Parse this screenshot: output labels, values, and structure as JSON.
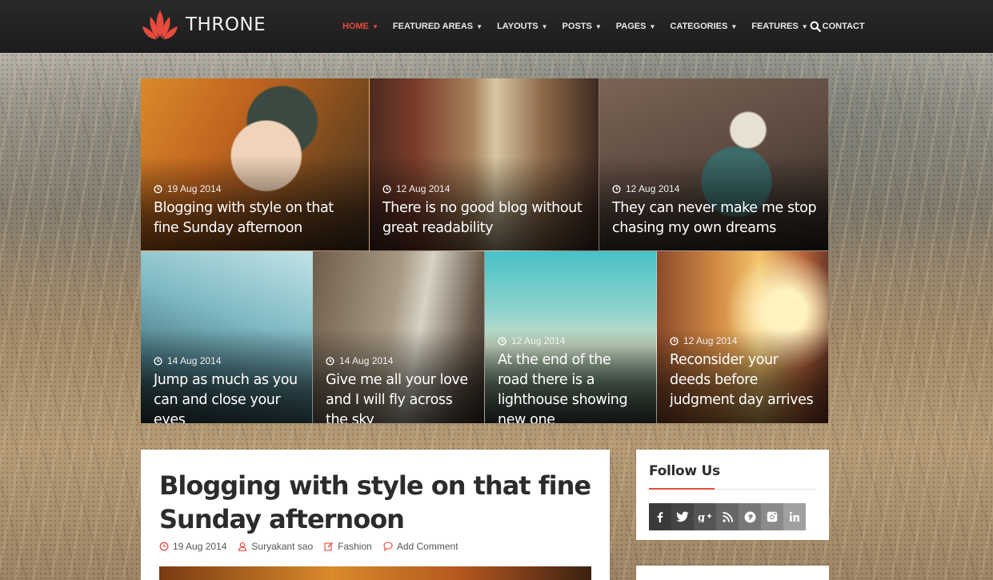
{
  "header": {
    "logo_text": "THRONE",
    "nav": [
      {
        "label": "HOME",
        "active": true,
        "has_dropdown": true
      },
      {
        "label": "FEATURED AREAS",
        "has_dropdown": true
      },
      {
        "label": "LAYOUTS",
        "has_dropdown": true
      },
      {
        "label": "POSTS",
        "has_dropdown": true
      },
      {
        "label": "PAGES",
        "has_dropdown": true
      },
      {
        "label": "CATEGORIES",
        "has_dropdown": true
      },
      {
        "label": "FEATURES",
        "has_dropdown": true
      },
      {
        "label": "CONTACT",
        "has_dropdown": false
      }
    ],
    "search_icon": "search-icon"
  },
  "featured": [
    {
      "date": "19 Aug 2014",
      "title": "Blogging with style on that fine Sunday afternoon"
    },
    {
      "date": "12 Aug 2014",
      "title": "There is no good blog without great readability"
    },
    {
      "date": "12 Aug 2014",
      "title": "They can never make me stop chasing my own dreams"
    },
    {
      "date": "14 Aug 2014",
      "title": "Jump as much as you can and close your eyes"
    },
    {
      "date": "14 Aug 2014",
      "title": "Give me all your love and I will fly across the sky"
    },
    {
      "date": "12 Aug 2014",
      "title": "At the end of the road there is a lighthouse showing new one"
    },
    {
      "date": "12 Aug 2014",
      "title": "Reconsider your deeds before judgment day arrives"
    }
  ],
  "post": {
    "title": "Blogging with style on that fine Sunday afternoon",
    "date": "19 Aug 2014",
    "author": "Suryakant sao",
    "category": "Fashion",
    "comments": "Add Comment"
  },
  "sidebar": {
    "follow_title": "Follow Us",
    "socials": [
      {
        "icon": "facebook-icon",
        "glyph": "f",
        "color": "#3a3a3a"
      },
      {
        "icon": "twitter-icon",
        "glyph": "t",
        "color": "#444444"
      },
      {
        "icon": "google-plus-icon",
        "glyph": "g+",
        "color": "#555555"
      },
      {
        "icon": "rss-icon",
        "glyph": "rss",
        "color": "#666666"
      },
      {
        "icon": "pinterest-icon",
        "glyph": "p",
        "color": "#777777"
      },
      {
        "icon": "instagram-icon",
        "glyph": "ig",
        "color": "#8a8a8a"
      },
      {
        "icon": "linkedin-icon",
        "glyph": "in",
        "color": "#a0a0a0"
      }
    ]
  },
  "colors": {
    "accent": "#e54b3c",
    "topbar": "#222222"
  }
}
